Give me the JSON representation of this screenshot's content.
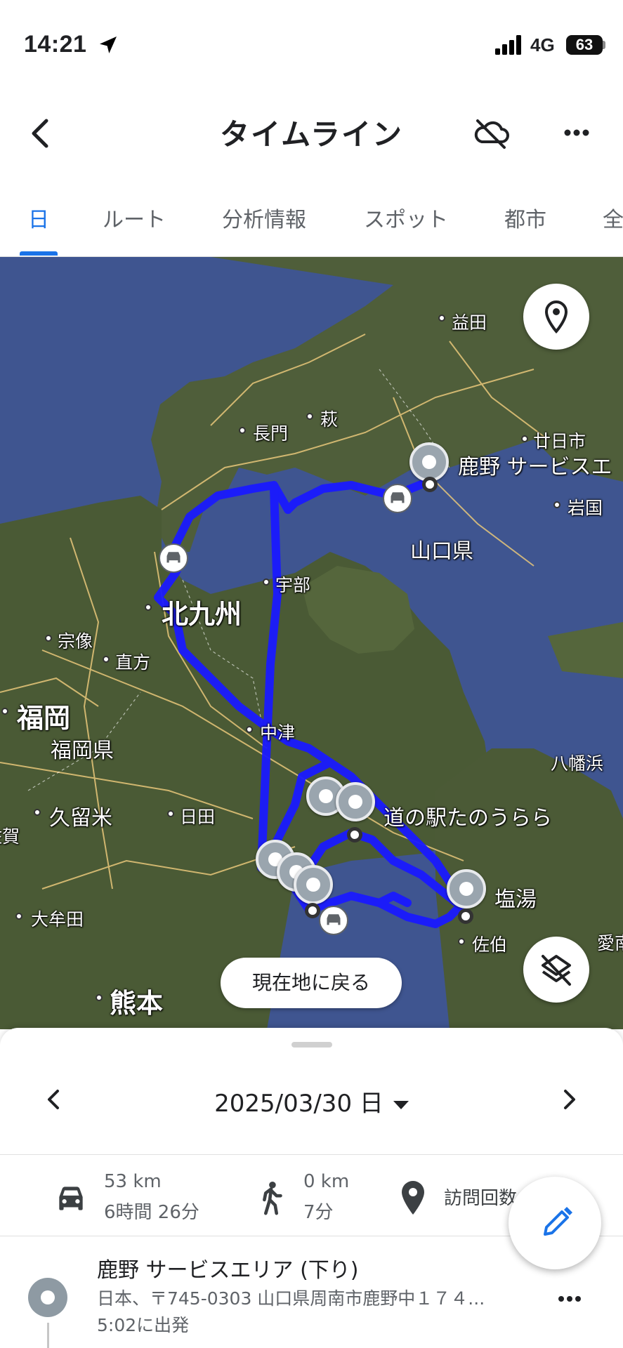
{
  "status_bar": {
    "time": "14:21",
    "network": "4G",
    "battery": "63"
  },
  "app_bar": {
    "title": "タイムライン"
  },
  "tabs": [
    {
      "label": "日",
      "active": true
    },
    {
      "label": "ルート",
      "active": false
    },
    {
      "label": "分析情報",
      "active": false
    },
    {
      "label": "スポット",
      "active": false
    },
    {
      "label": "都市",
      "active": false
    },
    {
      "label": "全",
      "active": false
    }
  ],
  "map": {
    "labels": {
      "masuda": "益田",
      "hagi": "萩",
      "nagato": "長門",
      "hatsukaichi": "廿日市",
      "kano_sa": "鹿野 サービスエ",
      "iwakuni": "岩国",
      "yamaguchi_ken": "山口県",
      "ube": "宇部",
      "kitakyushu": "北九州",
      "munakata": "宗像",
      "nogata": "直方",
      "fukuoka": "福岡",
      "fukuoka_ken": "福岡県",
      "nakatsu": "中津",
      "yawatahama": "八幡浜",
      "kurume": "久留米",
      "hita": "日田",
      "saga_partial": "佐賀",
      "michinoeki": "道の駅たのうらら",
      "shioyu": "塩湯",
      "omuta": "大牟田",
      "saiki": "佐伯",
      "aino_partial": "愛南",
      "kumamoto": "熊本"
    },
    "return_button": "現在地に戻る",
    "route_color": "#1a1aff",
    "water_color": "#3f5590"
  },
  "sheet": {
    "date": "2025/03/30 日",
    "stats": {
      "drive_distance": "53 km",
      "drive_time": "6時間 26分",
      "walk_distance": "0 km",
      "walk_time": "7分",
      "visits_label": "訪問回数"
    },
    "entry": {
      "title": "鹿野 サービスエリア (下り)",
      "address": "日本、〒745-0303 山口県周南市鹿野中１７４...",
      "time": "5:02に出発"
    }
  },
  "icons": {
    "back": "chevron-left-icon",
    "cloud_off": "cloud-off-icon",
    "more": "more-horiz-icon",
    "pin": "map-pin-icon",
    "layers_off": "layers-off-icon",
    "car": "car-icon",
    "walk": "walk-icon",
    "place": "place-icon",
    "edit": "pencil-icon"
  }
}
